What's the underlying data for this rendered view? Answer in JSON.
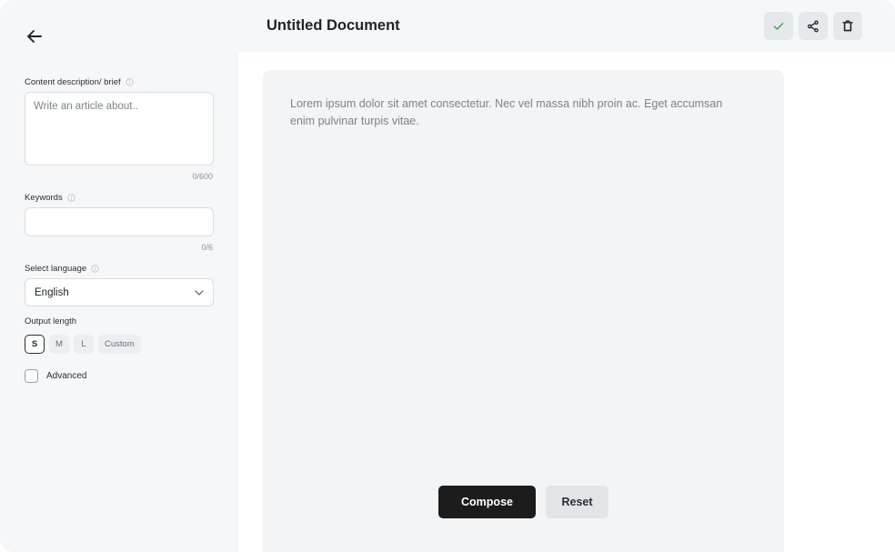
{
  "header": {
    "title": "Untitled Document",
    "actions": [
      {
        "icon": "check-icon",
        "color": "#2fa84f"
      },
      {
        "icon": "share-icon"
      },
      {
        "icon": "trash-icon"
      }
    ]
  },
  "sidebar": {
    "back_icon": "arrow-left-icon",
    "content_brief": {
      "label": "Content description/ brief",
      "placeholder": "Write an article about..",
      "counter": "0/600"
    },
    "keywords": {
      "label": "Keywords",
      "value": "",
      "counter": "0/6"
    },
    "language": {
      "label": "Select language",
      "selected": "English"
    },
    "output_length": {
      "label": "Output length",
      "options": [
        "S",
        "M",
        "L",
        "Custom"
      ],
      "selected": "S"
    },
    "advanced": {
      "label": "Advanced",
      "checked": false
    }
  },
  "editor": {
    "text": "Lorem ipsum dolor sit amet consectetur. Nec vel massa nibh proin ac. Eget accumsan enim pulvinar turpis vitae.",
    "compose_label": "Compose",
    "reset_label": "Reset"
  }
}
